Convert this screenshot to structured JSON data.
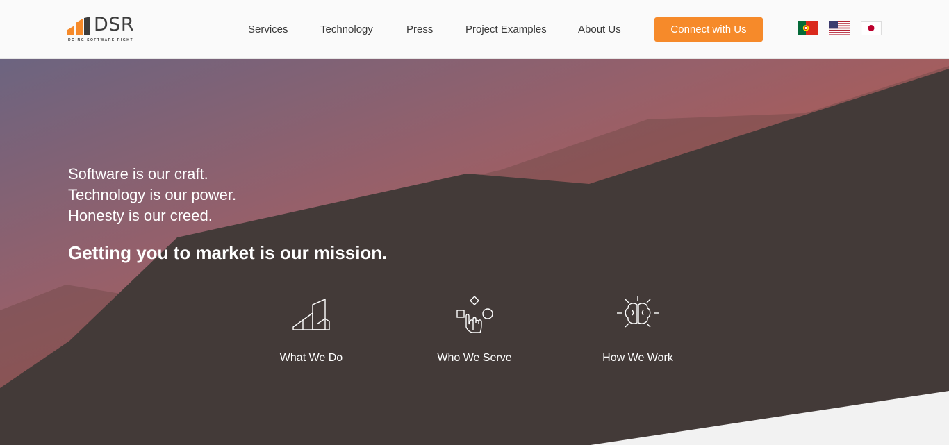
{
  "brand": {
    "name": "DSR",
    "tagline": "DOING SOFTWARE RIGHT",
    "accent_color": "#f68a2a",
    "dark_color": "#433a38"
  },
  "nav": {
    "items": [
      {
        "label": "Services"
      },
      {
        "label": "Technology"
      },
      {
        "label": "Press"
      },
      {
        "label": "Project Examples"
      },
      {
        "label": "About Us"
      }
    ],
    "cta_label": "Connect with Us"
  },
  "languages": [
    {
      "icon": "portugal-flag-icon"
    },
    {
      "icon": "usa-flag-icon"
    },
    {
      "icon": "japan-flag-icon"
    }
  ],
  "hero": {
    "lines": [
      "Software is our craft.",
      "Technology is our power.",
      "Honesty is our creed."
    ],
    "mission": "Getting you to market is our mission."
  },
  "features": [
    {
      "label": "What We Do",
      "icon": "stairs-chart-icon"
    },
    {
      "label": "Who We Serve",
      "icon": "hand-shapes-icon"
    },
    {
      "label": "How We Work",
      "icon": "brain-icon"
    }
  ]
}
